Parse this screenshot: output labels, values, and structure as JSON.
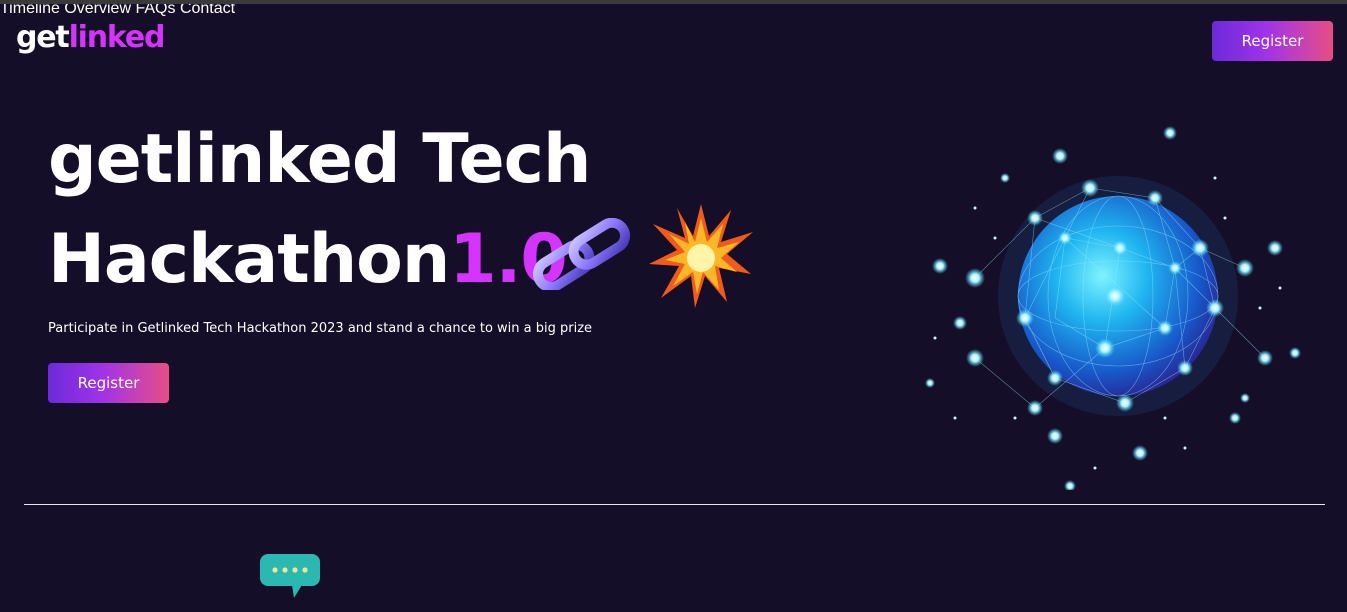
{
  "logo": {
    "part1": "get",
    "part2": "linked"
  },
  "nav": {
    "items": [
      {
        "label": "Timeline"
      },
      {
        "label": "Overview"
      },
      {
        "label": "FAQs"
      },
      {
        "label": "Contact"
      }
    ],
    "register_label": "Register"
  },
  "hero": {
    "title_line1": "getlinked Tech",
    "title_line2": "Hackathon",
    "version": "1.0",
    "subtitle": "Participate in Getlinked Tech Hackathon 2023 and stand a chance to win a big prize",
    "register_label": "Register",
    "icons": [
      "chain-link-icon",
      "explosion-burst-icon",
      "globe-network-image",
      "chat-bubble-icon"
    ]
  },
  "colors": {
    "background": "#150e28",
    "accent": "#d434fe",
    "button_gradient_start": "#6c2ad9",
    "button_gradient_end": "#e84e84"
  }
}
